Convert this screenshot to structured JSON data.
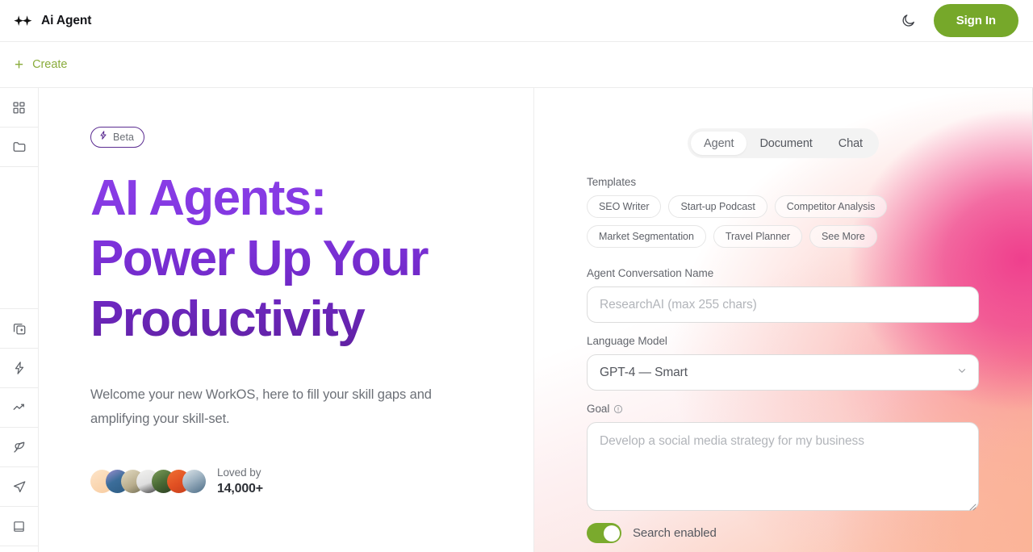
{
  "topbar": {
    "brand_title": "Ai Agent",
    "logo_icon": "sparkles-icon",
    "theme_toggle_icon": "moon-icon",
    "signin_label": "Sign In",
    "signin_color": "#76a82a"
  },
  "createbar": {
    "plus_glyph": "+",
    "create_label": "Create",
    "create_color": "#8aac3c"
  },
  "sidebar": {
    "items": [
      {
        "icon": "dashboard-grid-icon",
        "name": "sidebar-item-dashboard"
      },
      {
        "icon": "folder-icon",
        "name": "sidebar-item-folder"
      },
      {
        "icon": "copy-plus-icon",
        "name": "sidebar-item-duplicate"
      },
      {
        "icon": "lightning-bolt-icon",
        "name": "sidebar-item-automations"
      },
      {
        "icon": "trending-up-icon",
        "name": "sidebar-item-analytics"
      },
      {
        "icon": "feather-pen-icon",
        "name": "sidebar-item-write"
      },
      {
        "icon": "paper-plane-icon",
        "name": "sidebar-item-send"
      },
      {
        "icon": "book-icon",
        "name": "sidebar-item-library"
      }
    ]
  },
  "hero": {
    "badge": {
      "icon": "lightning-bolt-icon",
      "label": "Beta",
      "border_color": "#5b2c91"
    },
    "title_line1": "AI Agents:",
    "title_line2": "Power Up Your",
    "title_line3": "Productivity",
    "title_gradient_from": "#8b3fe8",
    "title_gradient_to": "#5f209f",
    "subtitle": "Welcome your new WorkOS, here to fill your skill gaps and amplifying your skill-set.",
    "loved_label": "Loved by",
    "loved_count": "14,000+",
    "avatar_colors": [
      "#fbd9bb",
      "#6f5fa8",
      "#cfc6ac",
      "#e8e8e6",
      "#5b7a45",
      "#e7612a",
      "#8fa5b8"
    ]
  },
  "panel": {
    "tabs": [
      {
        "label": "Agent",
        "active": true
      },
      {
        "label": "Document",
        "active": false
      },
      {
        "label": "Chat",
        "active": false
      }
    ],
    "templates_label": "Templates",
    "template_chips": [
      "SEO Writer",
      "Start-up Podcast",
      "Competitor Analysis",
      "Market Segmentation",
      "Travel Planner",
      "See More"
    ],
    "conversation_name_label": "Agent Conversation Name",
    "conversation_name_value": "",
    "conversation_name_placeholder": "ResearchAI (max 255 chars)",
    "language_model_label": "Language Model",
    "language_model_value": "GPT-4 — Smart",
    "language_model_chevron": "chevron-down-icon",
    "goal_label": "Goal",
    "goal_info_icon": "info-circle-icon",
    "goal_value": "",
    "goal_placeholder": "Develop a social media strategy for my business",
    "search_toggle_label": "Search enabled",
    "search_toggle_on": true,
    "search_toggle_color": "#7aaa2d",
    "gradient_pink": "#ef3f8d",
    "gradient_peach": "#fbb294"
  }
}
